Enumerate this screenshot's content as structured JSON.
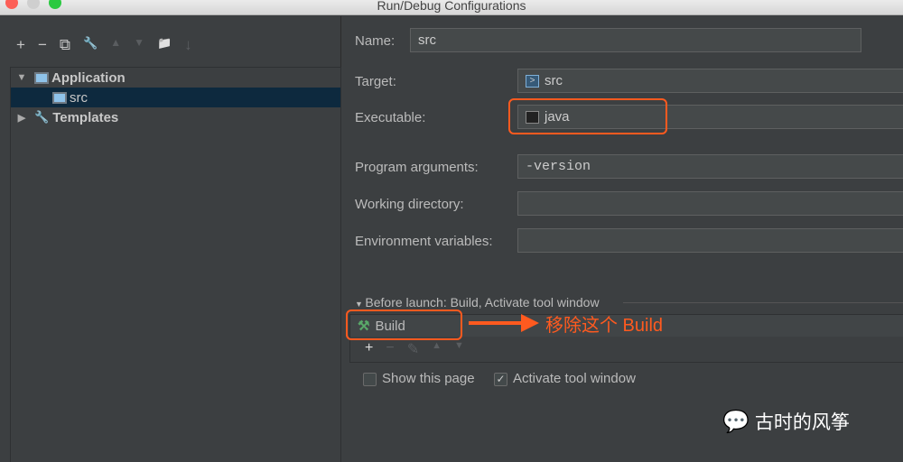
{
  "window": {
    "title": "Run/Debug Configurations"
  },
  "toolbar": {
    "add": "+",
    "remove": "−",
    "copy": "⧉",
    "edit": "🔧",
    "up": "▲",
    "down": "▼",
    "folder": "📁",
    "sort": "↓"
  },
  "tree": {
    "items": [
      {
        "label": "Application",
        "expanded": true
      },
      {
        "label": "src",
        "selected": true
      },
      {
        "label": "Templates",
        "expanded": false
      }
    ]
  },
  "form": {
    "name_label": "Name:",
    "name_value": "src",
    "target_label": "Target:",
    "target_value": "src",
    "executable_label": "Executable:",
    "executable_value": "java",
    "args_label": "Program arguments:",
    "args_value": "-version",
    "workdir_label": "Working directory:",
    "workdir_value": "",
    "env_label": "Environment variables:",
    "env_value": ""
  },
  "before_launch": {
    "header": "Before launch: Build, Activate tool window",
    "items": [
      "Build"
    ]
  },
  "options": {
    "show_page": "Show this page",
    "show_page_checked": false,
    "activate": "Activate tool window",
    "activate_checked": true
  },
  "annotation": {
    "text": "移除这个 Build",
    "color": "#ff5a1f"
  },
  "watermark": {
    "text": "古时的风筝"
  }
}
